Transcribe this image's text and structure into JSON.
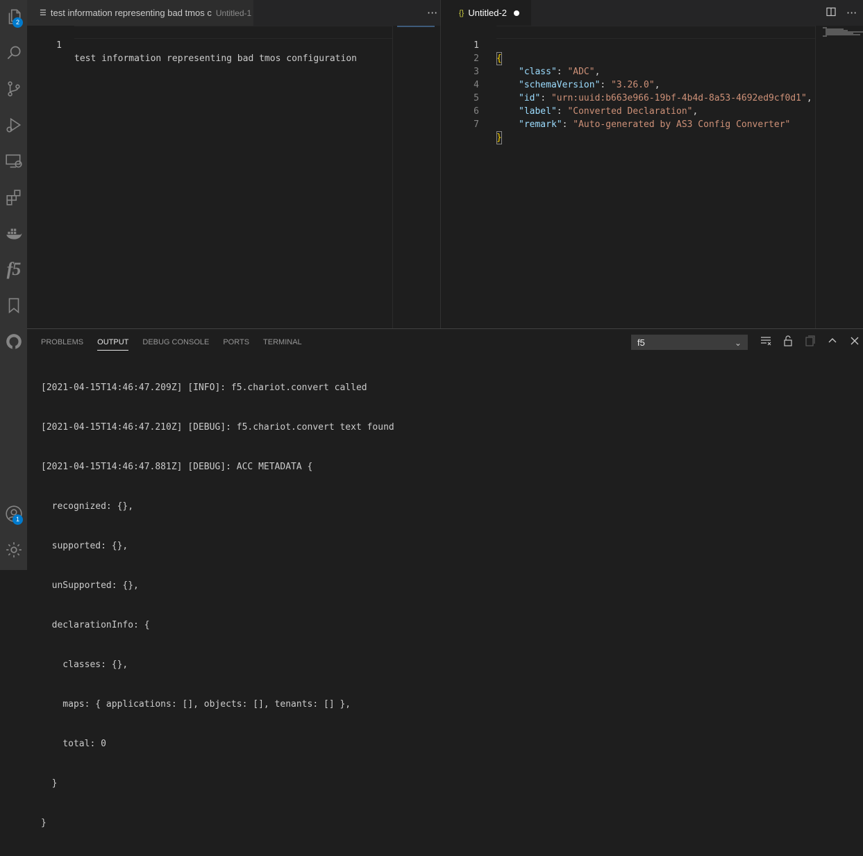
{
  "activity_bar": {
    "explorer_badge": "2",
    "accounts_badge": "1",
    "f5_label": "f5"
  },
  "left_editor": {
    "tab": {
      "label": "test information representing bad tmos c",
      "description": "Untitled-1"
    },
    "tab_more": "···",
    "lines": [
      {
        "number": "1",
        "text": "test information representing bad tmos configuration"
      }
    ]
  },
  "right_editor": {
    "tab": {
      "icon": "{}",
      "label": "Untitled-2"
    },
    "tab_more": "···",
    "line_numbers": [
      "1",
      "2",
      "3",
      "4",
      "5",
      "6",
      "7"
    ],
    "json_lines": [
      {
        "open": "{"
      },
      {
        "key": "\"class\"",
        "value": "\"ADC\"",
        "comma": ","
      },
      {
        "key": "\"schemaVersion\"",
        "value": "\"3.26.0\"",
        "comma": ","
      },
      {
        "key": "\"id\"",
        "value": "\"urn:uuid:b663e966-19bf-4b4d-8a53-4692ed9cf0d1\"",
        "comma": ","
      },
      {
        "key": "\"label\"",
        "value": "\"Converted Declaration\"",
        "comma": ","
      },
      {
        "key": "\"remark\"",
        "value": "\"Auto-generated by AS3 Config Converter\"",
        "comma": ""
      },
      {
        "close": "}"
      }
    ]
  },
  "panel": {
    "tabs": [
      "PROBLEMS",
      "OUTPUT",
      "DEBUG CONSOLE",
      "PORTS",
      "TERMINAL"
    ],
    "active_tab": "OUTPUT",
    "channel": "f5",
    "output_lines": [
      "[2021-04-15T14:46:47.209Z] [INFO]: f5.chariot.convert called",
      "[2021-04-15T14:46:47.210Z] [DEBUG]: f5.chariot.convert text found",
      "[2021-04-15T14:46:47.881Z] [DEBUG]: ACC METADATA {",
      "  recognized: {},",
      "  supported: {},",
      "  unSupported: {},",
      "  declarationInfo: {",
      "    classes: {},",
      "    maps: { applications: [], objects: [], tenants: [] },",
      "    total: 0",
      "  }",
      "}"
    ]
  },
  "colors": {
    "accent": "#007acc",
    "json_key": "#9cdcfe",
    "json_string": "#ce9178",
    "bracket": "#ffd700"
  }
}
